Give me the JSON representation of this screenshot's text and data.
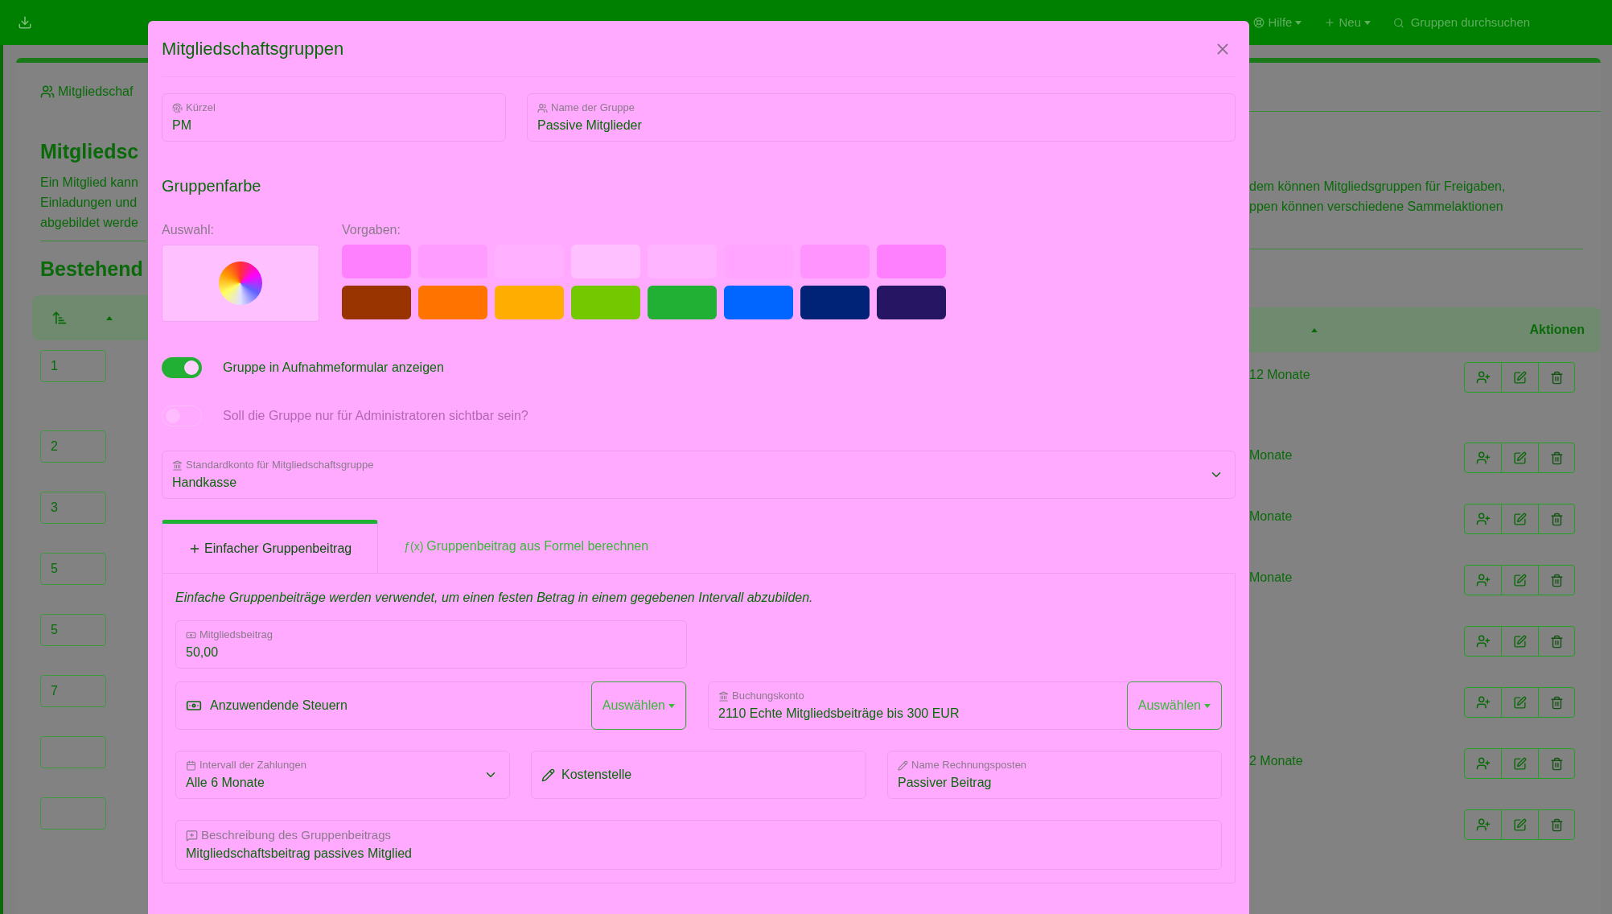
{
  "top_bar": {
    "help": "Hilfe",
    "new": "Neu",
    "search": {
      "placeholder": "Gruppen durchsuchen"
    }
  },
  "page": {
    "tab": "Mitgliedschaf",
    "heading": "Mitgliedsc",
    "intro_left": [
      "Ein Mitglied kann",
      "Einladungen und",
      "abgebildet werde"
    ],
    "intro_right": [
      "dem können Mitgliedsgruppen für Freigaben,",
      "ppen können verschiedene Sammelaktionen"
    ],
    "subheading": "Bestehend",
    "table": {
      "actions_column": "Aktionen",
      "rows": [
        {
          "order": "1",
          "interval": "12 Monate"
        },
        {
          "order": "2",
          "interval": "Monate"
        },
        {
          "order": "3",
          "interval": "Monate"
        },
        {
          "order": "5",
          "interval": "Monate"
        },
        {
          "order": "5"
        },
        {
          "order": "7"
        },
        {
          "interval": "2 Monate"
        },
        {}
      ]
    }
  },
  "dialog": {
    "title": "Mitgliedschaftsgruppen",
    "short_name": {
      "label": "Kürzel",
      "value": "PM"
    },
    "group_name": {
      "label": "Name der Gruppe",
      "value": "Passive Mitglieder"
    },
    "color_section": "Gruppenfarbe",
    "picker_label": "Auswahl:",
    "presets_label": "Vorgaben:",
    "presets": [
      {
        "color": "#ff80ff"
      },
      {
        "color": "#ff9cff"
      },
      {
        "color": "#ffb0ff"
      },
      {
        "color": "#ffc0ff"
      },
      {
        "color": "#ffb4ff"
      },
      {
        "color": "#ffa4ff"
      },
      {
        "color": "#ff94ff"
      },
      {
        "color": "#ff80ff"
      },
      {
        "color": "#993300"
      },
      {
        "color": "#ff7300"
      },
      {
        "color": "#ffad00"
      },
      {
        "color": "#73c800"
      },
      {
        "color": "#22b034"
      },
      {
        "color": "#0066ff"
      },
      {
        "color": "#002277"
      },
      {
        "color": "#261563"
      }
    ],
    "toggles": [
      {
        "label": "Gruppe in Aufnahmeformular anzeigen",
        "on": true,
        "disabled": false
      },
      {
        "label": "Soll die Gruppe nur für Administratoren sichtbar sein?",
        "on": false,
        "disabled": true
      }
    ],
    "default_account": {
      "label": "Standardkonto für Mitgliedschaftsgruppe",
      "value": "Handkasse"
    },
    "tabs": [
      {
        "label": "Einfacher Gruppenbeitrag",
        "selected": true,
        "kind": "plus"
      },
      {
        "label": "Gruppenbeitrag aus Formel berechnen",
        "selected": false,
        "kind": "formula",
        "symbol": "ƒ(x)"
      }
    ],
    "hint": "Einfache Gruppenbeiträge werden verwendet, um einen festen Betrag in einem gegebenen Intervall abzubilden.",
    "fee": {
      "label": "Mitgliedsbeitrag",
      "value": "50,00"
    },
    "taxes": {
      "label": "Anzuwendende Steuern",
      "button": "Auswählen"
    },
    "booking_account": {
      "label": "Buchungskonto",
      "value": "2110 Echte Mitgliedsbeiträge bis 300 EUR",
      "button": "Auswählen"
    },
    "interval": {
      "label": "Intervall der Zahlungen",
      "value": "Alle 6 Monate"
    },
    "cost_center": {
      "placeholder": "Kostenstelle"
    },
    "invoice_item": {
      "label": "Name Rechnungsposten",
      "value": "Passiver Beitrag"
    },
    "description": {
      "label": "Beschreibung des Gruppenbeitrags",
      "value": "Mitgliedschaftsbeitrag passives Mitglied"
    }
  }
}
